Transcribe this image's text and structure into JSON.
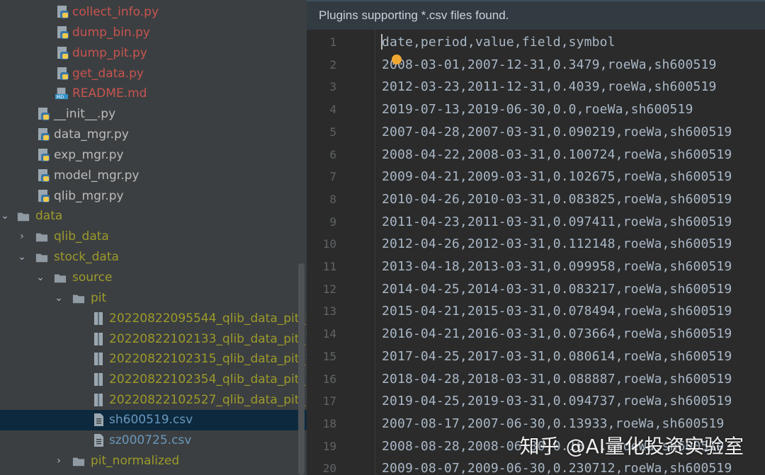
{
  "project_tree": {
    "items": [
      {
        "label": "collect_info.py",
        "type": "python"
      },
      {
        "label": "dump_bin.py",
        "type": "python"
      },
      {
        "label": "dump_pit.py",
        "type": "python"
      },
      {
        "label": "get_data.py",
        "type": "python"
      },
      {
        "label": "README.md",
        "type": "markdown"
      },
      {
        "label": "__init__.py",
        "type": "python"
      },
      {
        "label": "data_mgr.py",
        "type": "python"
      },
      {
        "label": "exp_mgr.py",
        "type": "python"
      },
      {
        "label": "model_mgr.py",
        "type": "python"
      },
      {
        "label": "qlib_mgr.py",
        "type": "python"
      },
      {
        "label": "data",
        "type": "folder"
      },
      {
        "label": "qlib_data",
        "type": "folder"
      },
      {
        "label": "stock_data",
        "type": "folder"
      },
      {
        "label": "source",
        "type": "folder"
      },
      {
        "label": "pit",
        "type": "folder"
      },
      {
        "label": "20220822095544_qlib_data_pit_1",
        "type": "archive"
      },
      {
        "label": "20220822102133_qlib_data_pit_1",
        "type": "archive"
      },
      {
        "label": "20220822102315_qlib_data_pit_1",
        "type": "archive"
      },
      {
        "label": "20220822102354_qlib_data_pit_1",
        "type": "archive"
      },
      {
        "label": "20220822102527_qlib_data_pit_1",
        "type": "archive"
      },
      {
        "label": "sh600519.csv",
        "type": "csv"
      },
      {
        "label": "sz000725.csv",
        "type": "csv"
      },
      {
        "label": "pit_normalized",
        "type": "folder"
      }
    ],
    "selected": "sh600519.csv"
  },
  "editor": {
    "banner": "Plugins supporting *.csv files found.",
    "lines": [
      {
        "num": "1",
        "text": "date,period,value,field,symbol"
      },
      {
        "num": "2",
        "text": "2008-03-01,2007-12-31,0.3479,roeWa,sh600519"
      },
      {
        "num": "3",
        "text": "2012-03-23,2011-12-31,0.4039,roeWa,sh600519"
      },
      {
        "num": "4",
        "text": "2019-07-13,2019-06-30,0.0,roeWa,sh600519"
      },
      {
        "num": "5",
        "text": "2007-04-28,2007-03-31,0.090219,roeWa,sh600519"
      },
      {
        "num": "6",
        "text": "2008-04-22,2008-03-31,0.100724,roeWa,sh600519"
      },
      {
        "num": "7",
        "text": "2009-04-21,2009-03-31,0.102675,roeWa,sh600519"
      },
      {
        "num": "8",
        "text": "2010-04-26,2010-03-31,0.083825,roeWa,sh600519"
      },
      {
        "num": "9",
        "text": "2011-04-23,2011-03-31,0.097411,roeWa,sh600519"
      },
      {
        "num": "10",
        "text": "2012-04-26,2012-03-31,0.112148,roeWa,sh600519"
      },
      {
        "num": "11",
        "text": "2013-04-18,2013-03-31,0.099958,roeWa,sh600519"
      },
      {
        "num": "12",
        "text": "2014-04-25,2014-03-31,0.083217,roeWa,sh600519"
      },
      {
        "num": "13",
        "text": "2015-04-21,2015-03-31,0.078494,roeWa,sh600519"
      },
      {
        "num": "14",
        "text": "2016-04-21,2016-03-31,0.073664,roeWa,sh600519"
      },
      {
        "num": "15",
        "text": "2017-04-25,2017-03-31,0.080614,roeWa,sh600519"
      },
      {
        "num": "16",
        "text": "2018-04-28,2018-03-31,0.088887,roeWa,sh600519"
      },
      {
        "num": "17",
        "text": "2019-04-25,2019-03-31,0.094737,roeWa,sh600519"
      },
      {
        "num": "18",
        "text": "2007-08-17,2007-06-30,0.13933,roeWa,sh600519"
      },
      {
        "num": "19",
        "text": "2008-08-28,2008-06-30,0.16...,roeWa,sh600519"
      },
      {
        "num": "20",
        "text": "2009-08-07,2009-06-30,0.230712,roeWa,sh600519"
      }
    ]
  },
  "watermark": "知乎 @AI量化投资实验室",
  "colors": {
    "sidebar_bg": "#3c3f41",
    "editor_bg": "#2b2b2b",
    "selected_row": "#0d293e",
    "vcs_modified_red": "#c75450",
    "ignored_olive": "#9c9a2b"
  }
}
